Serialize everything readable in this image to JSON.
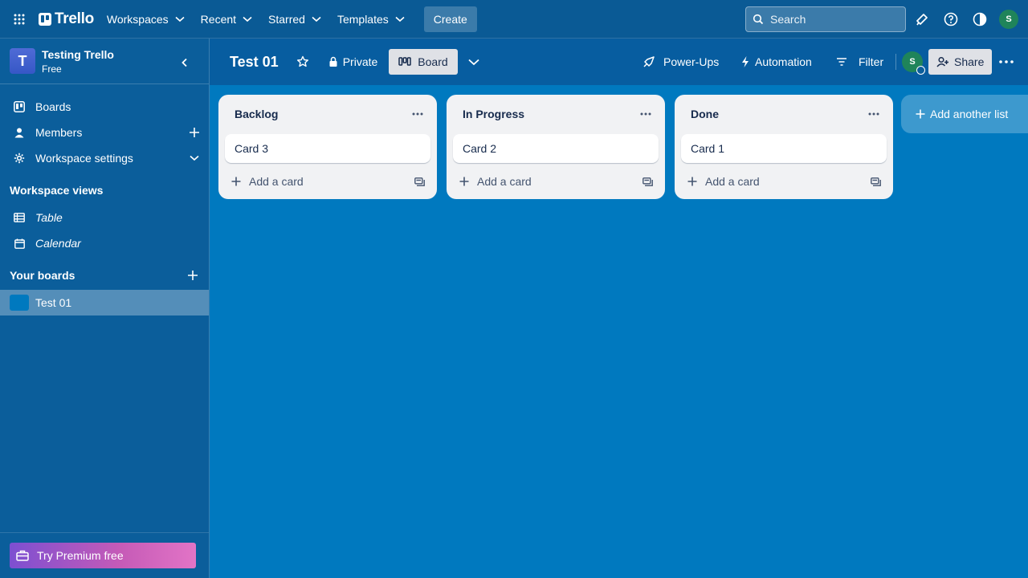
{
  "topbar": {
    "logo": "Trello",
    "nav": [
      {
        "label": "Workspaces"
      },
      {
        "label": "Recent"
      },
      {
        "label": "Starred"
      },
      {
        "label": "Templates"
      }
    ],
    "create_label": "Create",
    "search_placeholder": "Search",
    "avatar_initial": "S"
  },
  "sidebar": {
    "workspace_initial": "T",
    "workspace_name": "Testing Trello",
    "workspace_plan": "Free",
    "items": [
      {
        "label": "Boards",
        "icon": "trello-board-icon"
      },
      {
        "label": "Members",
        "icon": "person-icon"
      },
      {
        "label": "Workspace settings",
        "icon": "gear-icon"
      }
    ],
    "views_heading": "Workspace views",
    "views": [
      {
        "label": "Table",
        "icon": "table-icon"
      },
      {
        "label": "Calendar",
        "icon": "calendar-icon"
      }
    ],
    "boards_heading": "Your boards",
    "boards": [
      {
        "label": "Test 01",
        "color": "#0079bf"
      }
    ],
    "premium_label": "Try Premium free"
  },
  "board": {
    "title": "Test 01",
    "visibility_label": "Private",
    "view_label": "Board",
    "powerups_label": "Power-Ups",
    "automation_label": "Automation",
    "filter_label": "Filter",
    "member_initial": "S",
    "share_label": "Share",
    "lists": [
      {
        "title": "Backlog",
        "cards": [
          "Card 3"
        ],
        "add_label": "Add a card"
      },
      {
        "title": "In Progress",
        "cards": [
          "Card 2"
        ],
        "add_label": "Add a card"
      },
      {
        "title": "Done",
        "cards": [
          "Card 1"
        ],
        "add_label": "Add a card"
      }
    ],
    "add_list_label": "Add another list"
  },
  "colors": {
    "board_bg": "#0079bf",
    "topbar_bg": "#0a5a95",
    "sidebar_bg": "#0b5e9b",
    "avatar_green": "#1f845a",
    "list_bg": "#f1f2f4"
  }
}
